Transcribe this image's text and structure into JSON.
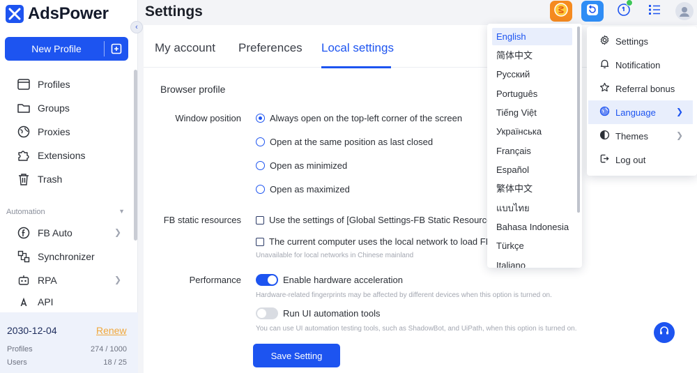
{
  "app": {
    "name": "AdsPower"
  },
  "header": {
    "title": "Settings"
  },
  "sidebar": {
    "new_profile": "New Profile",
    "items": [
      {
        "label": "Profiles",
        "icon": "browser-window-icon"
      },
      {
        "label": "Groups",
        "icon": "folder-icon"
      },
      {
        "label": "Proxies",
        "icon": "globe-icon"
      },
      {
        "label": "Extensions",
        "icon": "puzzle-icon"
      },
      {
        "label": "Trash",
        "icon": "trash-icon"
      }
    ],
    "section_automation": "Automation",
    "automation_items": [
      {
        "label": "FB Auto",
        "icon": "facebook-icon"
      },
      {
        "label": "Synchronizer",
        "icon": "sync-icon"
      },
      {
        "label": "RPA",
        "icon": "robot-icon"
      },
      {
        "label": "API",
        "icon": "api-icon"
      }
    ],
    "expiry_date": "2030-12-04",
    "renew": "Renew",
    "profiles_label": "Profiles",
    "profiles_value": "274 / 1000",
    "users_label": "Users",
    "users_value": "18 / 25"
  },
  "tabs": [
    {
      "label": "My account"
    },
    {
      "label": "Preferences"
    },
    {
      "label": "Local settings"
    }
  ],
  "local_settings": {
    "section": "Browser profile",
    "window_position": {
      "label": "Window position",
      "options": [
        "Always open on the top-left corner of the screen",
        "Open at the same position as last closed",
        "Open as minimized",
        "Open as maximized"
      ],
      "selected_index": 0
    },
    "fb_static": {
      "label": "FB static resources",
      "option1": "Use the settings of [Global Settings-FB Static Resources]",
      "option2": "The current computer uses the local network to load FB",
      "hint": "Unavailable for local networks in Chinese mainland"
    },
    "performance": {
      "label": "Performance",
      "hw_accel": "Enable hardware acceleration",
      "hw_accel_on": true,
      "hw_hint": "Hardware-related fingerprints may be affected by different devices when this option is turned on.",
      "ui_auto": "Run UI automation tools",
      "ui_auto_on": false,
      "ui_hint": "You can use UI automation testing tools, such as ShadowBot, and UiPath, when this option is turned on."
    },
    "save": "Save Setting"
  },
  "languages": [
    "English",
    "简体中文",
    "Русский",
    "Português",
    "Tiếng Việt",
    "Українська",
    "Français",
    "Español",
    "繁体中文",
    "แบบไทย",
    "Bahasa Indonesia",
    "Türkçe",
    "Italiano"
  ],
  "menu": [
    {
      "label": "Settings",
      "icon": "gear-icon"
    },
    {
      "label": "Notification",
      "icon": "bell-icon"
    },
    {
      "label": "Referral bonus",
      "icon": "star-icon"
    },
    {
      "label": "Language",
      "icon": "globe-icon"
    },
    {
      "label": "Themes",
      "icon": "theme-icon"
    },
    {
      "label": "Log out",
      "icon": "logout-icon"
    }
  ],
  "colors": {
    "accent": "#1d54f0",
    "renew": "#f0a73a"
  }
}
